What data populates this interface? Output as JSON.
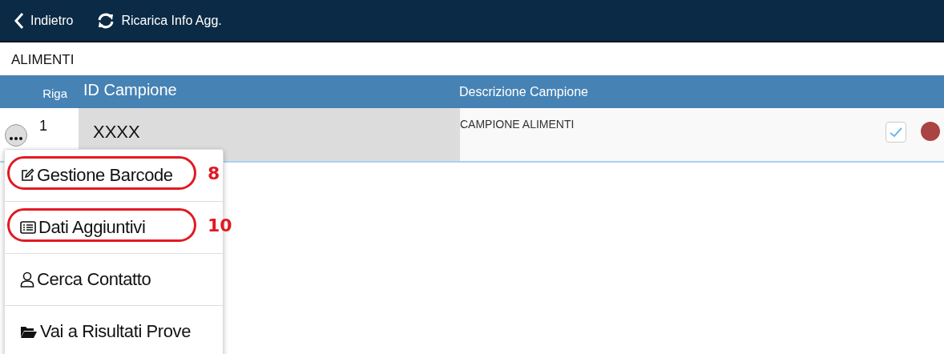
{
  "toolbar": {
    "buttons": [
      {
        "kind": "back",
        "label": "Indietro"
      },
      {
        "kind": "reload",
        "label": "Ricarica Info Agg."
      }
    ]
  },
  "section_title": "ALIMENTI",
  "table": {
    "columns": [
      "Riga",
      "ID Campione",
      "Descrizione Campione"
    ],
    "rows": [
      {
        "riga": "1",
        "id": "XXXX",
        "descrizione": "CAMPIONE ALIMENTI",
        "checked": true,
        "color": "#a94442"
      }
    ]
  },
  "context_menu": {
    "items": [
      {
        "kind": "edit",
        "label": "Gestione Barcode",
        "callout": "8"
      },
      {
        "kind": "list",
        "label": "Dati Aggiuntivi",
        "callout": "10"
      },
      {
        "kind": "person",
        "label": "Cerca Contatto"
      },
      {
        "kind": "folder",
        "label": "Vai a Risultati Prove"
      }
    ]
  }
}
